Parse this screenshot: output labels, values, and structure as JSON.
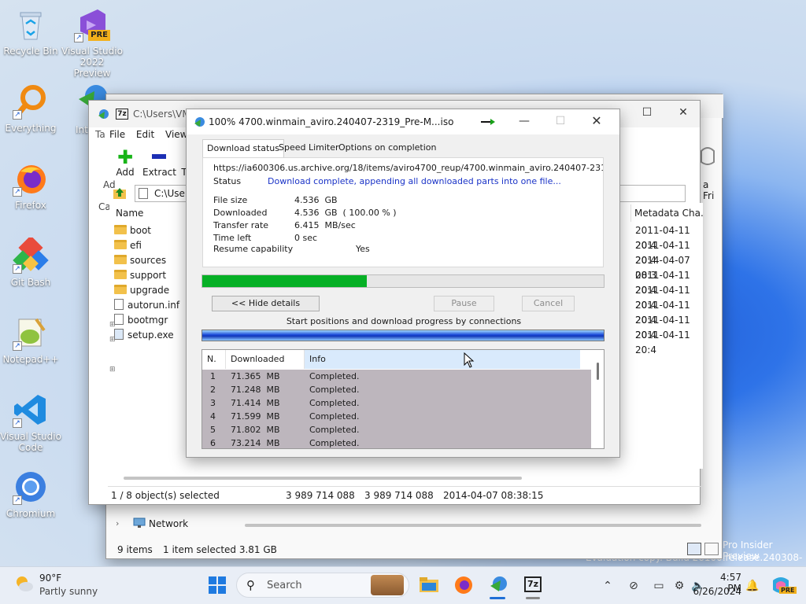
{
  "desktop": {
    "icons": [
      {
        "label": "Recycle Bin",
        "icon": "recycle-bin-icon"
      },
      {
        "label": "Visual Studio 2022 Preview",
        "icon": "visual-studio-preview-icon",
        "badge": "PRE"
      },
      {
        "label": "Everything",
        "icon": "everything-search-icon"
      },
      {
        "label": "Firefox",
        "icon": "firefox-icon"
      },
      {
        "label": "Git Bash",
        "icon": "git-bash-icon"
      },
      {
        "label": "Notepad++",
        "icon": "notepad-plus-plus-icon"
      },
      {
        "label": "Visual Studio Code",
        "icon": "vscode-icon"
      },
      {
        "label": "Chromium",
        "icon": "chromium-icon"
      },
      {
        "label": "Inte Dov",
        "icon": "internet-download-manager-icon"
      }
    ],
    "watermark_line1": "Pro Insider Preview",
    "watermark_line2": "Evaluation copy. Build 26100.release.240308-1400"
  },
  "explorer": {
    "left_text": "Ta",
    "left_text2": "Ad",
    "left_text3": "Ca",
    "status_items": "9 items",
    "status_selected": "1 item selected  3.81 GB",
    "network_label": "Network",
    "right_text": "a Fri"
  },
  "sevenzip": {
    "title": "C:\\Users\\VM",
    "app_badge": "7z",
    "menu": [
      "File",
      "Edit",
      "View"
    ],
    "tools": [
      {
        "label": "Add",
        "icon": "add-icon"
      },
      {
        "label": "Extract",
        "icon": "extract-icon"
      },
      {
        "label": "T",
        "icon": "test-icon"
      }
    ],
    "address": "C:\\Users\\",
    "columns": {
      "name": "Name",
      "metadata": "Metadata Cha..."
    },
    "files": [
      {
        "name": "boot",
        "type": "folder",
        "date": "2011-04-11 20:4"
      },
      {
        "name": "efi",
        "type": "folder",
        "date": "2011-04-11 20:4"
      },
      {
        "name": "sources",
        "type": "folder",
        "date": "2014-04-07 08:3"
      },
      {
        "name": "support",
        "type": "folder",
        "date": "2011-04-11 20:4"
      },
      {
        "name": "upgrade",
        "type": "folder",
        "date": "2011-04-11 20:4"
      },
      {
        "name": "autorun.inf",
        "type": "file",
        "date": "2011-04-11 20:4"
      },
      {
        "name": "bootmgr",
        "type": "file",
        "date": "2011-04-11 20:4"
      },
      {
        "name": "setup.exe",
        "type": "exe",
        "date": "2011-04-11 20:4"
      }
    ],
    "status": {
      "selected": "1 / 8 object(s) selected",
      "size1": "3 989 714 088",
      "size2": "3 989 714 088",
      "date": "2014-04-07 08:38:15"
    }
  },
  "idm": {
    "title": "100% 4700.winmain_aviro.240407-2319_Pre-M...iso",
    "tabs": [
      "Download status",
      "Speed Limiter",
      "Options on completion"
    ],
    "url": "https://ia600306.us.archive.org/18/items/aviro4700_reup/4700.winmain_aviro.240407-2319_Pre-M",
    "status_label": "Status",
    "status_value": "Download complete, appending all downloaded parts into one file...",
    "fields": [
      {
        "label": "File size",
        "value": "4.536  GB"
      },
      {
        "label": "Downloaded",
        "value": "4.536  GB  ( 100.00 % )"
      },
      {
        "label": "Transfer rate",
        "value": "6.415  MB/sec"
      },
      {
        "label": "Time left",
        "value": "0 sec"
      }
    ],
    "resume_label": "Resume capability",
    "resume_value": "Yes",
    "progress": 0.41,
    "buttons": {
      "hide": "<< Hide details",
      "pause": "Pause",
      "cancel": "Cancel"
    },
    "connections_label": "Start positions and download progress by connections",
    "table_headers": [
      "N.",
      "Downloaded",
      "Info"
    ],
    "connections": [
      {
        "n": "1",
        "downloaded": "71.365  MB",
        "info": "Completed."
      },
      {
        "n": "2",
        "downloaded": "71.248  MB",
        "info": "Completed."
      },
      {
        "n": "3",
        "downloaded": "71.414  MB",
        "info": "Completed."
      },
      {
        "n": "4",
        "downloaded": "71.599  MB",
        "info": "Completed."
      },
      {
        "n": "5",
        "downloaded": "71.802  MB",
        "info": "Completed."
      },
      {
        "n": "6",
        "downloaded": "73.214  MB",
        "info": "Completed."
      }
    ]
  },
  "taskbar": {
    "weather_temp": "90°F",
    "weather_desc": "Partly sunny",
    "search_placeholder": "Search",
    "clock_time": "4:57 PM",
    "clock_date": "6/26/2024",
    "copilot_badge": "PRE",
    "app_7z": "7z"
  },
  "colors": {
    "progress_green": "#06b025",
    "status_blue": "#1a33c7",
    "taskbar": "#e9eef6",
    "connection_row": "#bdb6bd"
  }
}
